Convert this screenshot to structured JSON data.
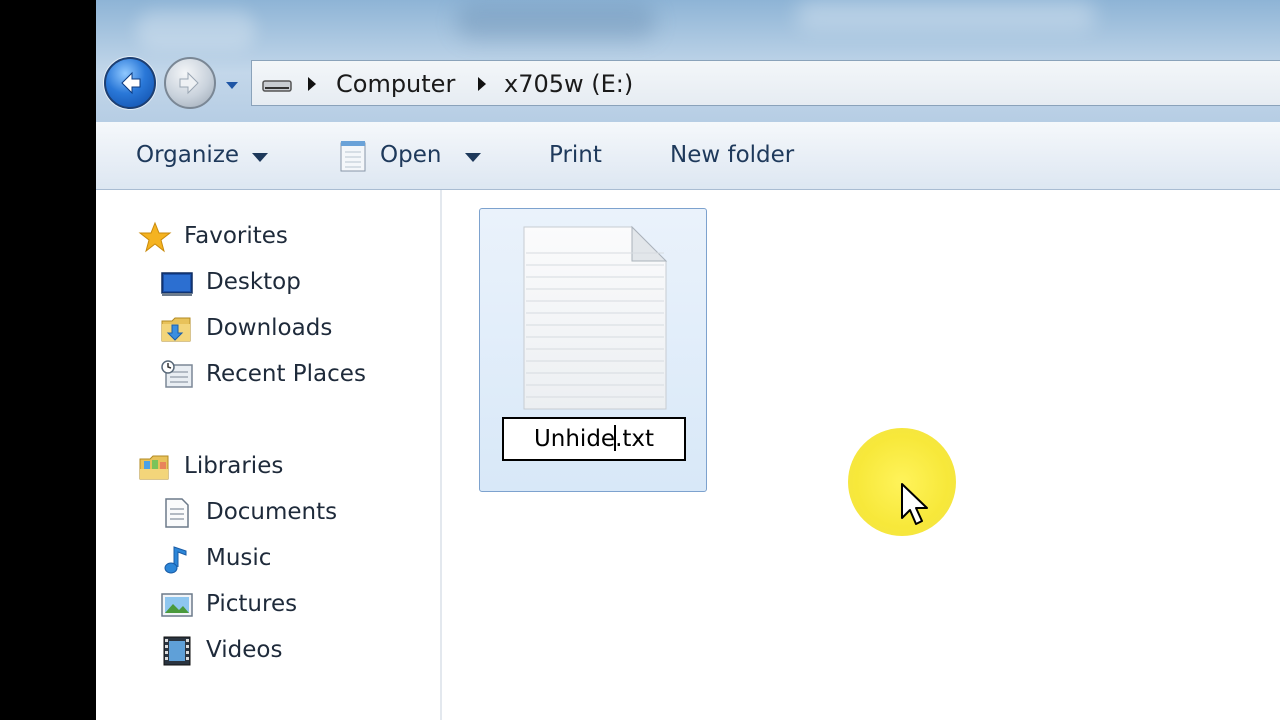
{
  "address_bar": {
    "crumbs": [
      "Computer",
      "x705w (E:)"
    ]
  },
  "toolbar": {
    "organize_label": "Organize",
    "open_label": "Open",
    "print_label": "Print",
    "new_folder_label": "New folder"
  },
  "sidebar": {
    "favorites": {
      "label": "Favorites",
      "items": [
        {
          "label": "Desktop",
          "icon": "desktop-icon"
        },
        {
          "label": "Downloads",
          "icon": "downloads-folder-icon"
        },
        {
          "label": "Recent Places",
          "icon": "recent-places-icon"
        }
      ]
    },
    "libraries": {
      "label": "Libraries",
      "items": [
        {
          "label": "Documents",
          "icon": "documents-icon"
        },
        {
          "label": "Music",
          "icon": "music-icon"
        },
        {
          "label": "Pictures",
          "icon": "pictures-icon"
        },
        {
          "label": "Videos",
          "icon": "videos-icon"
        }
      ]
    }
  },
  "files": [
    {
      "name_before_caret": "Unhide",
      "name_after_caret": ".txt",
      "icon": "text-document-icon",
      "state": "renaming",
      "selected": true
    }
  ],
  "colors": {
    "selection_fill": "#d8e8f8",
    "selection_border": "#7da2ce",
    "cursor_highlight": "#f7e83a",
    "command_text": "#1e395b"
  }
}
